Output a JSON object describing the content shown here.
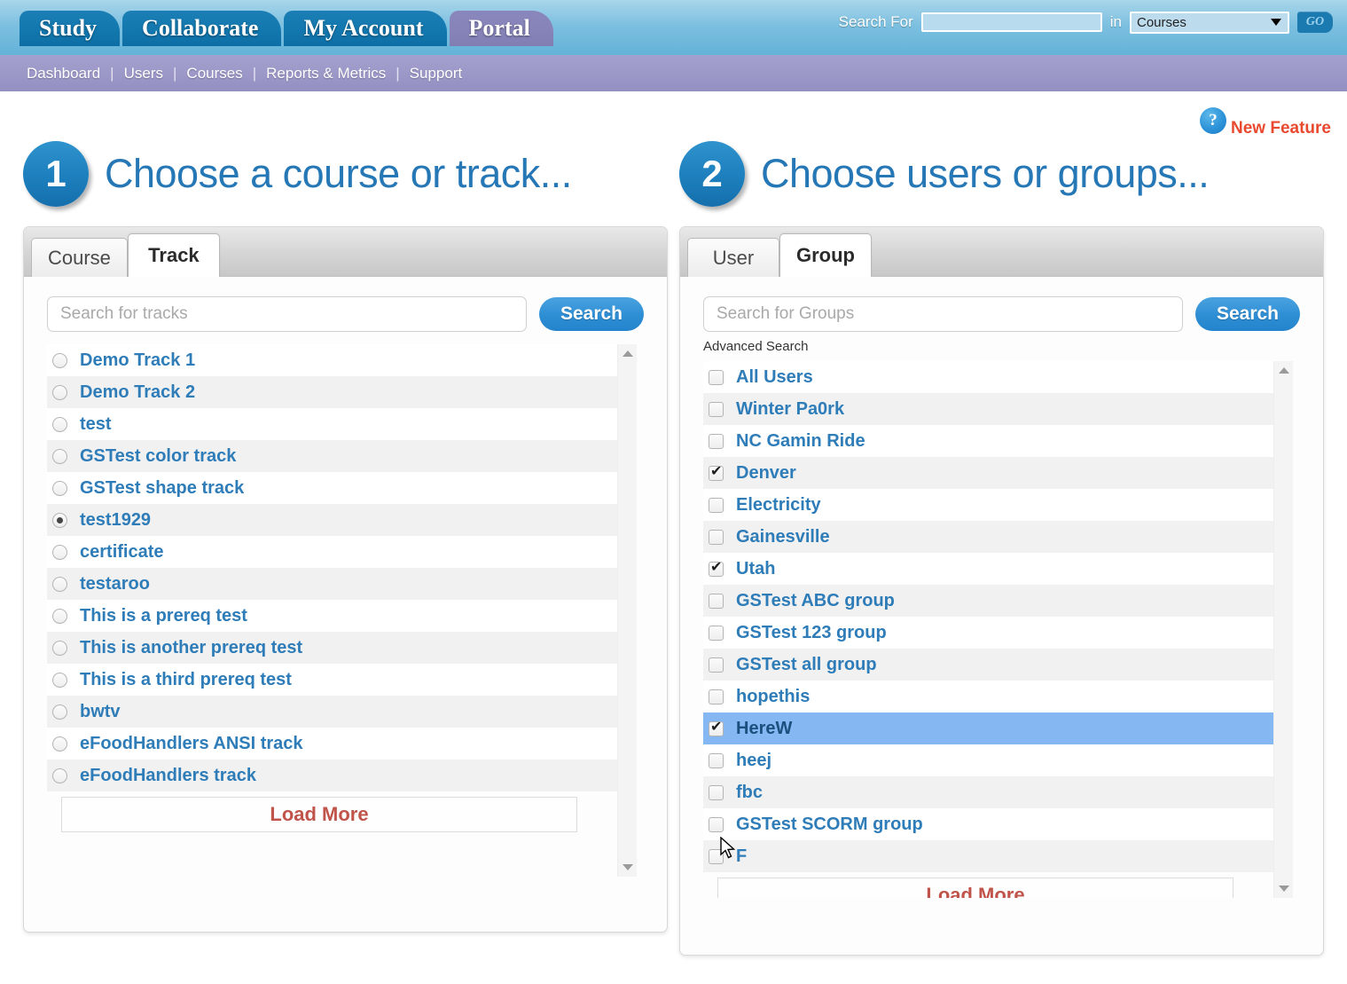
{
  "topbar": {
    "tabs": [
      {
        "label": "Study",
        "active": false
      },
      {
        "label": "Collaborate",
        "active": false
      },
      {
        "label": "My Account",
        "active": false
      },
      {
        "label": "Portal",
        "active": true
      }
    ],
    "search_for_label": "Search For",
    "search_for_value": "",
    "search_for_placeholder": "",
    "in_label": "in",
    "scope_selected": "Courses",
    "scope_options": [
      "Courses"
    ],
    "go_label": "GO"
  },
  "nav": {
    "items": [
      "Dashboard",
      "Users",
      "Courses",
      "Reports & Metrics",
      "Support"
    ],
    "separator": "|"
  },
  "new_feature": {
    "help_icon": "question-mark-icon",
    "label": "New Feature",
    "color": "#e8492f"
  },
  "step1": {
    "number": "1",
    "title": "Choose a course or track...",
    "tabs": [
      {
        "label": "Course",
        "active": false
      },
      {
        "label": "Track",
        "active": true
      }
    ],
    "search_placeholder": "Search for tracks",
    "search_value": "",
    "search_button": "Search",
    "load_more": "Load More",
    "items": [
      {
        "label": "Demo Track 1",
        "selected": false
      },
      {
        "label": "Demo Track 2",
        "selected": false
      },
      {
        "label": "test",
        "selected": false
      },
      {
        "label": "GSTest color track",
        "selected": false
      },
      {
        "label": "GSTest shape track",
        "selected": false
      },
      {
        "label": "test1929",
        "selected": true
      },
      {
        "label": "certificate",
        "selected": false
      },
      {
        "label": "testaroo",
        "selected": false
      },
      {
        "label": "This is a prereq test",
        "selected": false
      },
      {
        "label": "This is another prereq test",
        "selected": false
      },
      {
        "label": "This is a third prereq test",
        "selected": false
      },
      {
        "label": "bwtv",
        "selected": false
      },
      {
        "label": "eFoodHandlers ANSI track",
        "selected": false
      },
      {
        "label": "eFoodHandlers track",
        "selected": false
      }
    ]
  },
  "step2": {
    "number": "2",
    "title": "Choose users or groups...",
    "tabs": [
      {
        "label": "User",
        "active": false
      },
      {
        "label": "Group",
        "active": true
      }
    ],
    "search_placeholder": "Search for Groups",
    "search_value": "",
    "search_button": "Search",
    "advanced_search": "Advanced Search",
    "load_more": "Load More",
    "items": [
      {
        "label": "All Users",
        "checked": false,
        "highlighted": false
      },
      {
        "label": "Winter Pa0rk",
        "checked": false,
        "highlighted": false
      },
      {
        "label": "NC Gamin Ride",
        "checked": false,
        "highlighted": false
      },
      {
        "label": "Denver",
        "checked": true,
        "highlighted": false
      },
      {
        "label": "Electricity",
        "checked": false,
        "highlighted": false
      },
      {
        "label": "Gainesville",
        "checked": false,
        "highlighted": false
      },
      {
        "label": "Utah",
        "checked": true,
        "highlighted": false
      },
      {
        "label": "GSTest ABC group",
        "checked": false,
        "highlighted": false
      },
      {
        "label": "GSTest 123 group",
        "checked": false,
        "highlighted": false
      },
      {
        "label": "GSTest all group",
        "checked": false,
        "highlighted": false
      },
      {
        "label": "hopethis",
        "checked": false,
        "highlighted": false
      },
      {
        "label": "HereW",
        "checked": true,
        "highlighted": true
      },
      {
        "label": "heej",
        "checked": false,
        "highlighted": false
      },
      {
        "label": "fbc",
        "checked": false,
        "highlighted": false
      },
      {
        "label": "GSTest SCORM group",
        "checked": false,
        "highlighted": false
      },
      {
        "label": "F",
        "checked": false,
        "highlighted": false
      }
    ]
  },
  "colors": {
    "brand_blue": "#2577b5",
    "nav_purple": "#9b98c8",
    "topbar_blue": "#7dc0e0",
    "link_blue": "#2e7cb8",
    "accent_red": "#c0544b",
    "highlight_blue": "#85b7f2"
  }
}
